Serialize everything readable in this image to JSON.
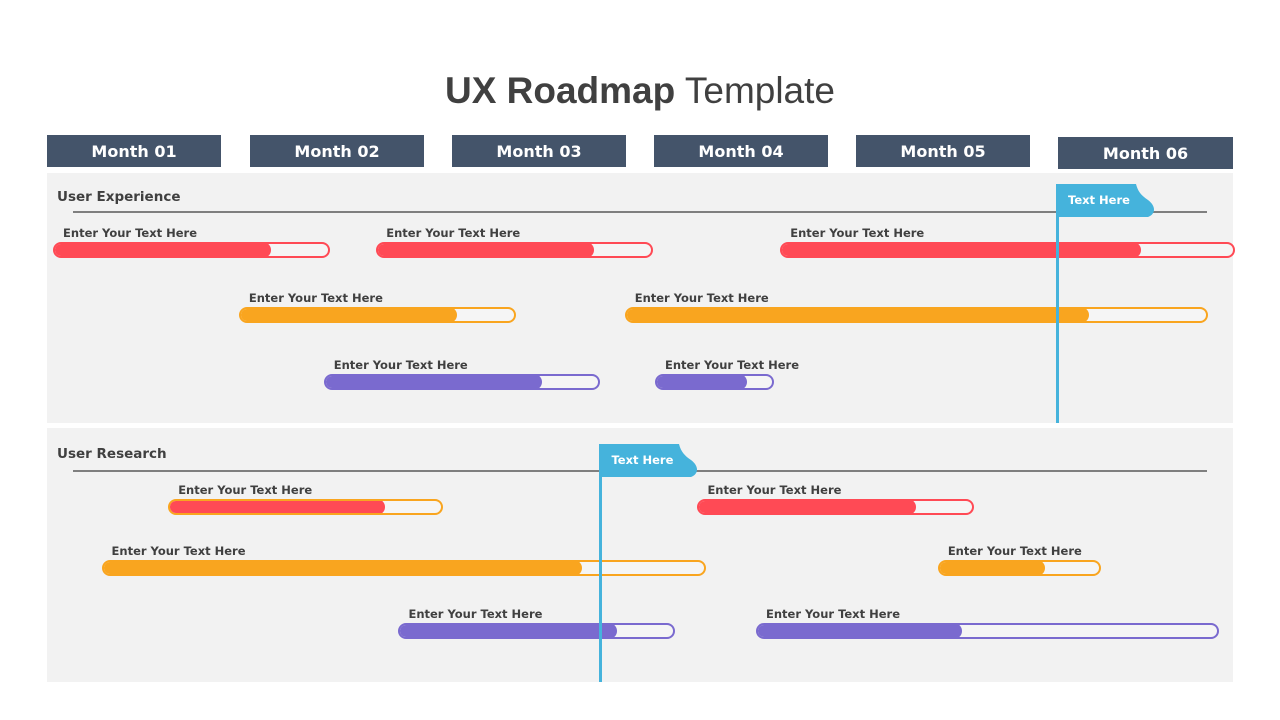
{
  "title": {
    "bold": "UX Roadmap",
    "regular": " Template"
  },
  "colors": {
    "header_bg": "#44546a",
    "panel_bg": "#f2f2f2",
    "red": "#ff4a55",
    "orange": "#f9a51f",
    "purple": "#7a6acf",
    "marker": "#45b3dc"
  },
  "months": [
    "Month 01",
    "Month 02",
    "Month 03",
    "Month 04",
    "Month 05",
    "Month 06"
  ],
  "sections": [
    {
      "title": "User Experience",
      "marker": {
        "label": "Text Here",
        "month_position": 5.0
      },
      "tasks": [
        {
          "label": "Enter Your Text Here",
          "color": "red",
          "outline": "red",
          "row": 0,
          "start_month": 0.03,
          "end_month": 1.4,
          "progress": 0.8
        },
        {
          "label": "Enter Your Text Here",
          "color": "red",
          "outline": "red",
          "row": 0,
          "start_month": 1.63,
          "end_month": 3.0,
          "progress": 0.8
        },
        {
          "label": "Enter Your Text Here",
          "color": "red",
          "outline": "red",
          "row": 0,
          "start_month": 3.63,
          "end_month": 5.88,
          "progress": 0.8
        },
        {
          "label": "Enter Your Text Here",
          "color": "orange",
          "outline": "orange",
          "row": 1,
          "start_month": 0.95,
          "end_month": 2.32,
          "progress": 0.8
        },
        {
          "label": "Enter Your Text Here",
          "color": "orange",
          "outline": "orange",
          "row": 1,
          "start_month": 2.86,
          "end_month": 5.75,
          "progress": 0.8
        },
        {
          "label": "Enter Your Text Here",
          "color": "purple",
          "outline": "purple",
          "row": 2,
          "start_month": 1.37,
          "end_month": 2.74,
          "progress": 0.8
        },
        {
          "label": "Enter Your Text Here",
          "color": "purple",
          "outline": "purple",
          "row": 2,
          "start_month": 3.01,
          "end_month": 3.6,
          "progress": 0.8
        }
      ]
    },
    {
      "title": "User Research",
      "marker": {
        "label": "Text Here",
        "month_position": 2.74
      },
      "tasks": [
        {
          "label": "Enter Your Text Here",
          "color": "red",
          "outline": "orange",
          "row": 0,
          "start_month": 0.6,
          "end_month": 1.96,
          "progress": 0.8
        },
        {
          "label": "Enter Your Text Here",
          "color": "red",
          "outline": "red",
          "row": 0,
          "start_month": 3.22,
          "end_month": 4.59,
          "progress": 0.8
        },
        {
          "label": "Enter Your Text Here",
          "color": "orange",
          "outline": "orange",
          "row": 1,
          "start_month": 0.27,
          "end_month": 3.26,
          "progress": 0.8
        },
        {
          "label": "Enter Your Text Here",
          "color": "orange",
          "outline": "orange",
          "row": 1,
          "start_month": 4.41,
          "end_month": 5.22,
          "progress": 0.67
        },
        {
          "label": "Enter Your Text Here",
          "color": "purple",
          "outline": "purple",
          "row": 2,
          "start_month": 1.74,
          "end_month": 3.11,
          "progress": 0.8
        },
        {
          "label": "Enter Your Text Here",
          "color": "purple",
          "outline": "purple",
          "row": 2,
          "start_month": 3.51,
          "end_month": 5.8,
          "progress": 0.45
        }
      ]
    }
  ]
}
